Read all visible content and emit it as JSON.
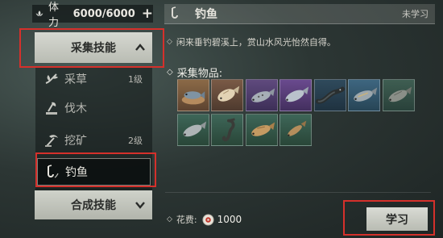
{
  "stamina": {
    "label": "体力",
    "value": "6000/6000",
    "add_symbol": "+"
  },
  "gathering": {
    "header": "采集技能",
    "items": [
      {
        "name": "采草",
        "level": "1级",
        "icon": "herb-icon"
      },
      {
        "name": "伐木",
        "level": "",
        "icon": "axe-icon"
      },
      {
        "name": "挖矿",
        "level": "2级",
        "icon": "pickaxe-icon"
      },
      {
        "name": "钓鱼",
        "level": "",
        "icon": "fishing-rod-icon",
        "selected": true
      }
    ]
  },
  "crafting": {
    "header": "合成技能"
  },
  "detail": {
    "title": "钓鱼",
    "status": "未学习",
    "description": "闲来垂钓碧溪上，赏山水风光怡然自得。",
    "items_title": "采集物品:",
    "bullet": "◇",
    "cost_label": "花费:",
    "cost_value": "1000",
    "learn_label": "学习"
  },
  "colors": {
    "highlight": "#d5302b",
    "button": "#c8cac2"
  },
  "fish_icons": [
    "platter-fish-icon",
    "pale-fish-icon",
    "spotted-fish-icon",
    "purple-fish-icon",
    "eel-icon",
    "blue-fish-icon",
    "green-fish-icon",
    "grey-fish-icon",
    "seahorse-icon",
    "golden-fish-icon",
    "small-fish-icon"
  ]
}
